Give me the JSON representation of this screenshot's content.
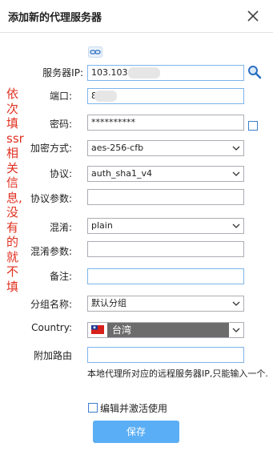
{
  "dialog": {
    "title": "添加新的代理服务器"
  },
  "form": {
    "server_ip_label": "服务器IP:",
    "server_ip_value": "103.103.",
    "port_label": "端口:",
    "port_value": "8",
    "password_label": "密码:",
    "password_value": "**********",
    "encryption_label": "加密方式:",
    "encryption_value": "aes-256-cfb",
    "protocol_label": "协议:",
    "protocol_value": "auth_sha1_v4",
    "protocol_param_label": "协议参数:",
    "protocol_param_value": "",
    "obfs_label": "混淆:",
    "obfs_value": "plain",
    "obfs_param_label": "混淆参数:",
    "obfs_param_value": "",
    "remark_label": "备注:",
    "remark_value": "",
    "group_label": "分组名称:",
    "group_value": "默认分组",
    "country_label": "Country:",
    "country_value": "台湾",
    "route_label": "附加路由",
    "route_value": "",
    "route_note": "本地代理所对应的远程服务器IP,只能输入一个.",
    "edit_activate_label": "编辑并激活使用",
    "save_label": "保存"
  },
  "annotation": {
    "side_note": "依次填ssr相关信息,没有的就不填"
  },
  "colors": {
    "annotation": "#e03020",
    "primary_button": "#5aaef5",
    "focus_border": "#7eb4ea"
  },
  "icons": [
    "close-icon",
    "link-icon",
    "search-icon",
    "chevron-down-icon",
    "taiwan-flag-icon"
  ]
}
